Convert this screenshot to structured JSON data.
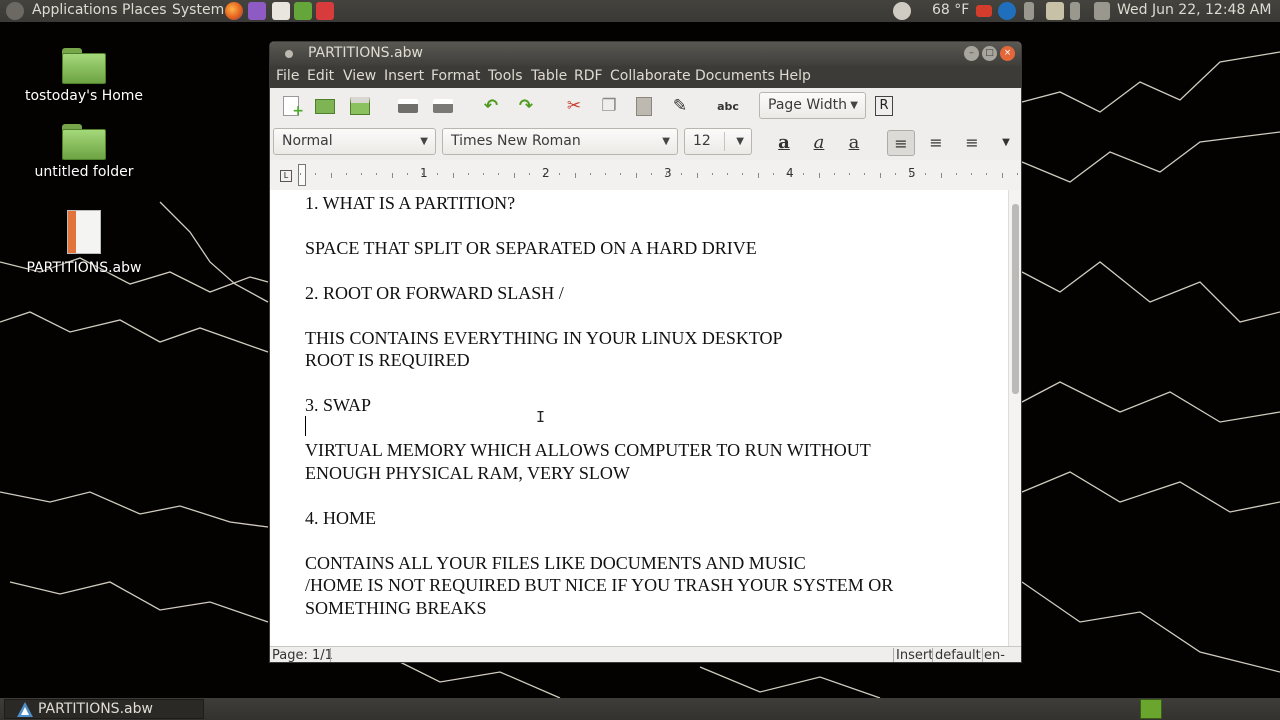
{
  "top_panel": {
    "menus": [
      "Applications",
      "Places",
      "System"
    ],
    "weather": "68 °F",
    "clock": "Wed Jun 22, 12:48 AM"
  },
  "desktop": {
    "icons": [
      {
        "label": "tostoday's Home"
      },
      {
        "label": "untitled folder"
      },
      {
        "label": "PARTITIONS.abw"
      }
    ]
  },
  "window": {
    "title": "PARTITIONS.abw",
    "menu": [
      "File",
      "Edit",
      "View",
      "Insert",
      "Format",
      "Tools",
      "Table",
      "RDF",
      "Collaborate",
      "Documents",
      "Help"
    ],
    "zoom": "Page Width",
    "style": "Normal",
    "font": "Times New Roman",
    "font_size": "12",
    "ruler_numbers": [
      "1",
      "2",
      "3",
      "4",
      "5"
    ],
    "lines": [
      "1. WHAT IS A PARTITION?",
      "SPACE THAT SPLIT OR SEPARATED ON  A HARD DRIVE",
      "2. ROOT OR FORWARD SLASH  /",
      "THIS CONTAINS  EVERYTHING IN YOUR LINUX DESKTOP",
      "ROOT IS REQUIRED",
      "3.  SWAP",
      "VIRTUAL MEMORY  WHICH ALLOWS COMPUTER TO RUN WITHOUT",
      "ENOUGH PHYSICAL RAM, VERY SLOW",
      "4.  HOME",
      "CONTAINS ALL YOUR FILES LIKE DOCUMENTS AND  MUSIC",
      "/HOME IS NOT REQUIRED  BUT NICE IF YOU TRASH YOUR SYSTEM OR",
      "SOMETHING BREAKS"
    ],
    "status": {
      "page": "Page: 1/1",
      "mode": "Insert",
      "style": "default",
      "lang": "en-US"
    }
  },
  "taskbar": {
    "task_label": "PARTITIONS.abw"
  },
  "colors": {
    "panel": "#3c3b37",
    "folder_green": "#8cc15f",
    "wallpaper_crack": "#ddd6c8"
  }
}
